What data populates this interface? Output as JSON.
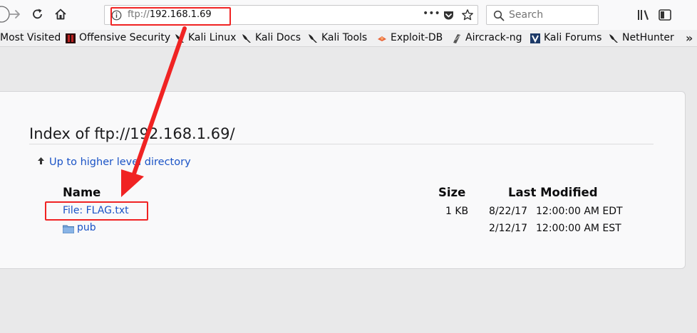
{
  "browser": {
    "url_scheme": "ftp://",
    "url_host": "192.168.1.69",
    "search_placeholder": "Search",
    "page_actions_glyph": "•••",
    "icons": [
      "back-icon",
      "forward-icon",
      "reload-icon",
      "home-icon",
      "info-icon",
      "pocket-icon",
      "star-icon",
      "search-icon",
      "library-icon",
      "sidebar-icon"
    ]
  },
  "bookmarks": {
    "items": [
      {
        "label": "Most Visited",
        "icon": "none"
      },
      {
        "label": "Offensive Security",
        "icon": "offsec-icon"
      },
      {
        "label": "Kali Linux",
        "icon": "kali-dragon-icon"
      },
      {
        "label": "Kali Docs",
        "icon": "kali-dragon-icon"
      },
      {
        "label": "Kali Tools",
        "icon": "kali-dragon-icon"
      },
      {
        "label": "Exploit-DB",
        "icon": "exploitdb-icon"
      },
      {
        "label": "Aircrack-ng",
        "icon": "aircrack-icon"
      },
      {
        "label": "Kali Forums",
        "icon": "kali-forums-icon"
      },
      {
        "label": "NetHunter",
        "icon": "kali-dragon-icon"
      }
    ],
    "overflow": "»"
  },
  "listing": {
    "title": "Index of ftp://192.168.1.69/",
    "up_link": "Up to higher level directory",
    "columns": {
      "name": "Name",
      "size": "Size",
      "modified": "Last Modified"
    },
    "rows": [
      {
        "name": "File: FLAG.txt",
        "size": "1 KB",
        "date": "8/22/17",
        "time": "12:00:00 AM EDT",
        "type": "file"
      },
      {
        "name": "pub",
        "size": "",
        "date": "2/12/17",
        "time": "12:00:00 AM EST",
        "type": "folder"
      }
    ]
  },
  "annotation_colors": {
    "highlight": "#f02323"
  },
  "colors": {
    "link": "#1a53c6",
    "toolbar": "#f9f9fa",
    "page_bg": "#e9e9ea"
  }
}
